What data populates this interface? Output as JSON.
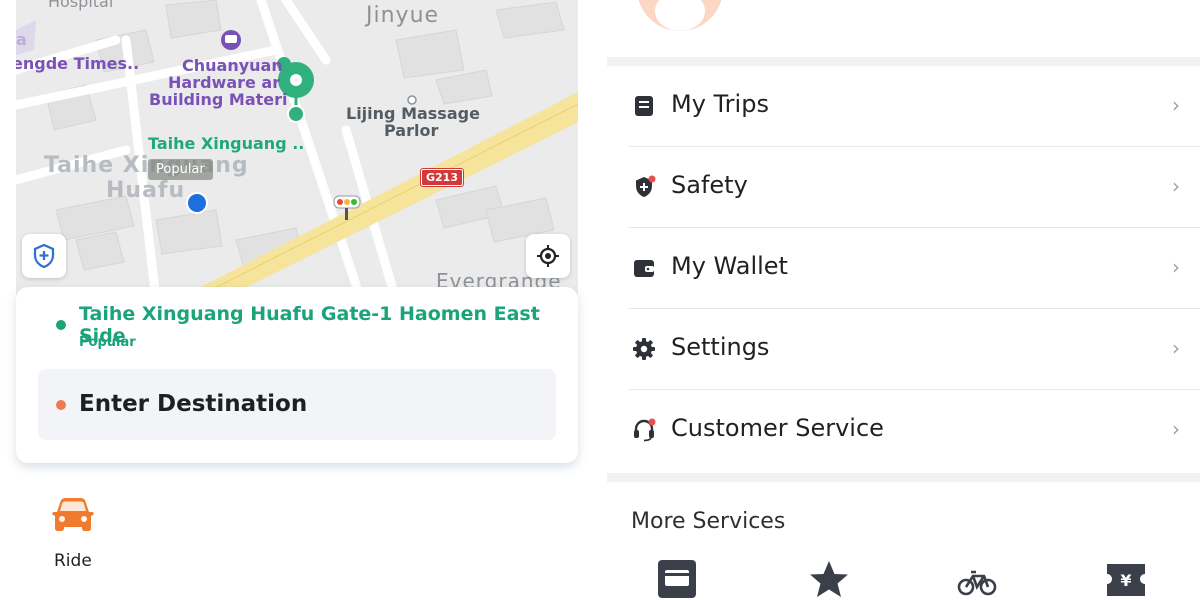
{
  "map": {
    "labels": {
      "hospital": "Hospital",
      "jinyue": "Jinyue",
      "shengde": "engde Times..",
      "chuanyuan_1": "Chuanyuan",
      "chuanyuan_2": "Hardware ar",
      "chuanyuan_3": "Building Materi",
      "lijing_1": "Lijing Massage",
      "lijing_2": "Parlor",
      "taihe_small": "Taihe Xinguang ..",
      "taihe_big_1": "Taihe Xinguang",
      "taihe_big_2": "Huafu",
      "evergrande": "Evergrande",
      "a_fragment": "a"
    },
    "popular_tag": "Popular",
    "road_badge": "G213"
  },
  "trip": {
    "pickup_name": "Taihe Xinguang Huafu Gate-1 Haomen East Side",
    "pickup_sub": "Popular",
    "destination_placeholder": "Enter Destination"
  },
  "services_left": [
    {
      "label": "Ride",
      "icon": "car-icon"
    }
  ],
  "menu": [
    {
      "label": "My Trips",
      "icon": "trips-icon"
    },
    {
      "label": "Safety",
      "icon": "shield-icon"
    },
    {
      "label": "My Wallet",
      "icon": "wallet-icon"
    },
    {
      "label": "Settings",
      "icon": "gear-icon"
    },
    {
      "label": "Customer Service",
      "icon": "headset-icon"
    }
  ],
  "more_services": {
    "title": "More Services",
    "icons": [
      "card-icon",
      "star-icon",
      "bike-icon",
      "ticket-icon"
    ]
  },
  "colors": {
    "green": "#1ba37a",
    "orange": "#ef7a4e",
    "purple": "#7a52b7",
    "road_yellow": "#f6e49a",
    "dark_icon": "#2e3138"
  }
}
